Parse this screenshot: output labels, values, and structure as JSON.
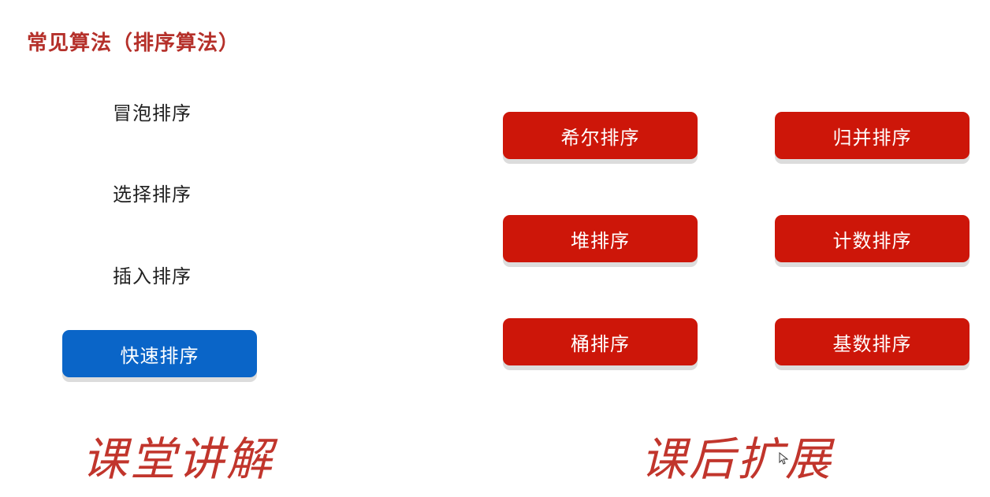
{
  "title": "常见算法（排序算法）",
  "lecture_items": [
    "冒泡排序",
    "选择排序",
    "插入排序"
  ],
  "lecture_highlight": "快速排序",
  "extension_items": [
    "希尔排序",
    "归并排序",
    "堆排序",
    "计数排序",
    "桶排序",
    "基数排序"
  ],
  "handwritten": {
    "left": "课堂讲解",
    "right": "课后扩展"
  },
  "colors": {
    "title": "#b5302a",
    "highlight_blue": "#0a65c8",
    "button_red": "#cd1609",
    "handwritten": "#c1352c"
  },
  "icons": {
    "cursor": "mouse-pointer-icon"
  }
}
